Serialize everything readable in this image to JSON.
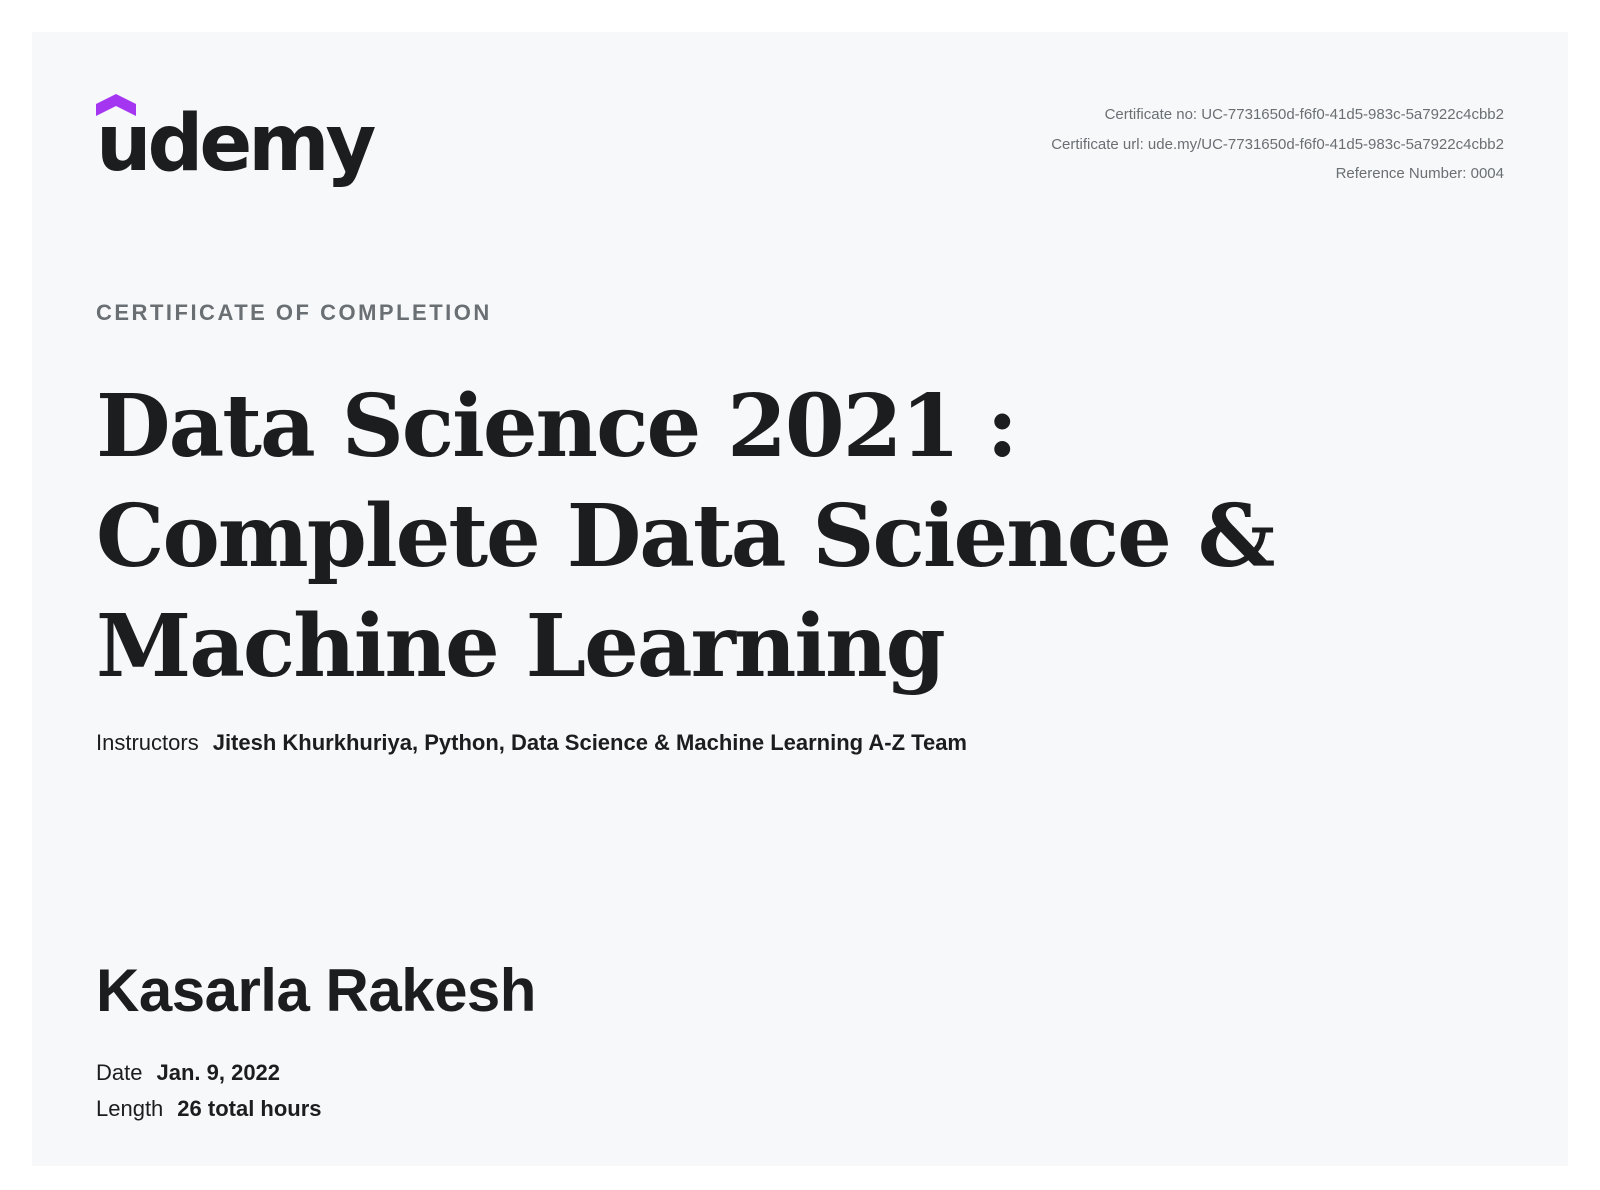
{
  "logo": {
    "text": "udemy",
    "hat_color": "#a435f0"
  },
  "certificate": {
    "number": "Certificate no: UC-7731650d-f6f0-41d5-983c-5a7922c4cbb2",
    "url": "Certificate url: ude.my/UC-7731650d-f6f0-41d5-983c-5a7922c4cbb2",
    "reference": "Reference Number: 0004"
  },
  "kicker": "CERTIFICATE OF COMPLETION",
  "course_title": "Data Science 2021 : Complete Data Science & Machine Learning",
  "instructors": {
    "label": "Instructors",
    "names": "Jitesh Khurkhuriya,  Python, Data Science & Machine Learning A-Z Team"
  },
  "recipient": "Kasarla Rakesh",
  "date": {
    "label": "Date",
    "value": "Jan. 9, 2022"
  },
  "length": {
    "label": "Length",
    "value": "26 total hours"
  },
  "colors": {
    "background": "#f7f8fa",
    "text": "#1c1d1f",
    "muted": "#6a6f73",
    "brand_purple": "#a435f0"
  }
}
